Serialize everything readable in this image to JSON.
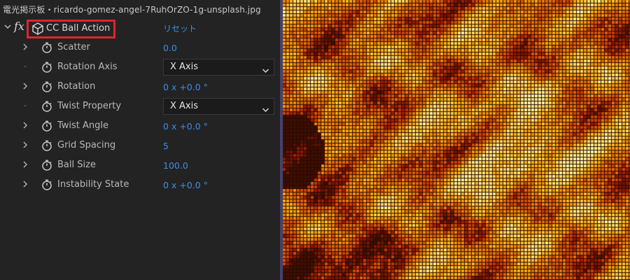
{
  "panel": {
    "file_title": "電光掲示板・ricardo-gomez-angel-7RuhOrZO-1g-unsplash.jpg",
    "effect": {
      "chevron_icon": "chevron-down-icon",
      "fx_label": "fx",
      "icon": "cube-icon",
      "name": "CC Ball Action",
      "reset_label": "リセット",
      "highlight_color": "#e0242c"
    },
    "properties": [
      {
        "label": "Scatter",
        "value": "0.0",
        "control": "value",
        "expandable": true,
        "name": "scatter"
      },
      {
        "label": "Rotation Axis",
        "value": "X Axis",
        "control": "dropdown",
        "expandable": false,
        "name": "rotation-axis"
      },
      {
        "label": "Rotation",
        "value": "0 x +0.0 °",
        "control": "value",
        "expandable": true,
        "name": "rotation"
      },
      {
        "label": "Twist Property",
        "value": "X Axis",
        "control": "dropdown",
        "expandable": false,
        "name": "twist-property"
      },
      {
        "label": "Twist Angle",
        "value": "0 x +0.0 °",
        "control": "value",
        "expandable": true,
        "name": "twist-angle"
      },
      {
        "label": "Grid Spacing",
        "value": "5",
        "control": "value",
        "expandable": true,
        "name": "grid-spacing"
      },
      {
        "label": "Ball Size",
        "value": "100.0",
        "control": "value",
        "expandable": true,
        "name": "ball-size"
      },
      {
        "label": "Instability State",
        "value": "0 x +0.0 °",
        "control": "value",
        "expandable": true,
        "name": "instability-state"
      }
    ]
  },
  "colors": {
    "panel_bg": "#232323",
    "value_blue": "#3a8ee8",
    "divider": "#45416a",
    "fire_orange": "#f59a12"
  },
  "viewer": {
    "content": "pixelated fire image (LED board effect)"
  }
}
